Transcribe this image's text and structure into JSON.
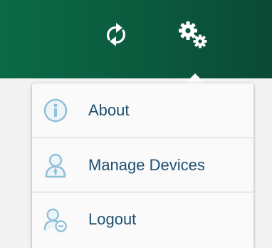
{
  "header": {
    "icons": [
      "sync-icon",
      "settings-gear-icon"
    ],
    "background_color": "#0b5a3e"
  },
  "menu": {
    "items": [
      {
        "label": "About",
        "icon": "info-icon"
      },
      {
        "label": "Manage Devices",
        "icon": "user-icon"
      },
      {
        "label": "Logout",
        "icon": "user-logout-icon"
      }
    ],
    "label_color": "#1e4f71",
    "icon_color": "#8fc0d8"
  }
}
